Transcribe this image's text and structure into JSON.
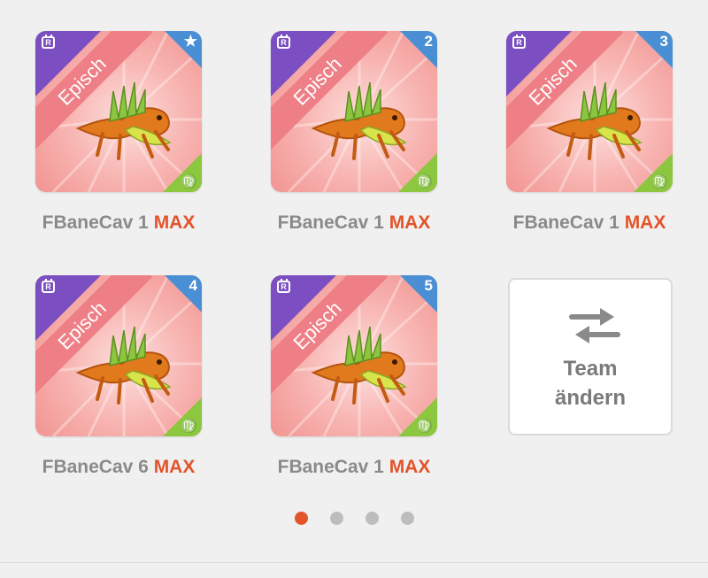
{
  "cards": [
    {
      "rarity": "Episch",
      "badge": "★",
      "name": "FBaneCav 1",
      "level": "MAX",
      "zodiac": "♍"
    },
    {
      "rarity": "Episch",
      "badge": "2",
      "name": "FBaneCav 1",
      "level": "MAX",
      "zodiac": "♍"
    },
    {
      "rarity": "Episch",
      "badge": "3",
      "name": "FBaneCav 1",
      "level": "MAX",
      "zodiac": "♍"
    },
    {
      "rarity": "Episch",
      "badge": "4",
      "name": "FBaneCav 6",
      "level": "MAX",
      "zodiac": "♍"
    },
    {
      "rarity": "Episch",
      "badge": "5",
      "name": "FBaneCav 1",
      "level": "MAX",
      "zodiac": "♍"
    }
  ],
  "change_team": {
    "line1": "Team",
    "line2": "ändern",
    "icon": "swap-arrows-icon"
  },
  "pagination": {
    "pages": 4,
    "current": 1
  },
  "colors": {
    "accent": "#e2542a",
    "rarity_purple": "#7b4fc1",
    "badge_blue": "#4a8fd4",
    "zodiac_green": "#8dc63f",
    "ribbon": "#ee7f86",
    "dot_inactive": "#bdbdbd"
  },
  "icons": {
    "rarity_icon": "r-rarity-icon",
    "zodiac_icon": "virgo-icon",
    "creature": "dragon-image"
  }
}
